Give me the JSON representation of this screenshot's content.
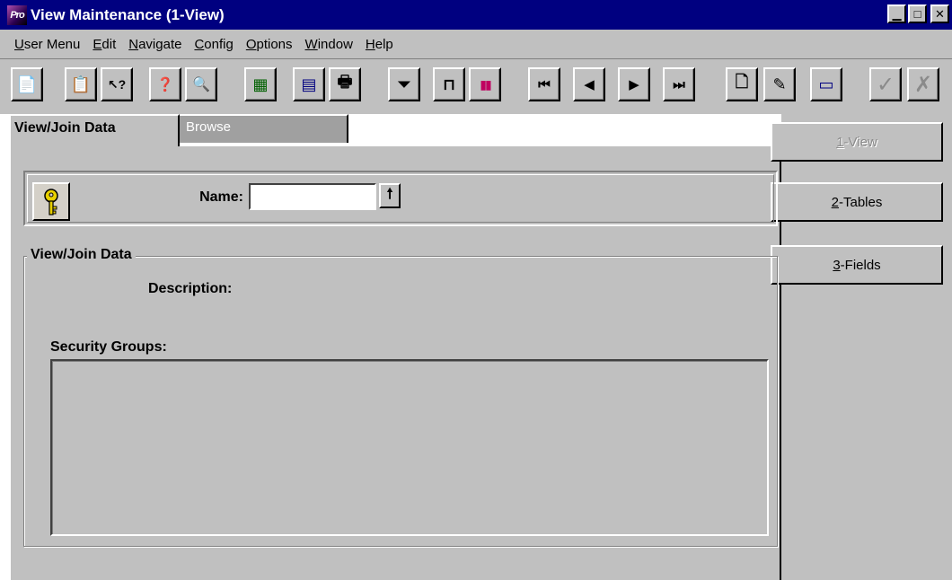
{
  "window": {
    "app_icon_text": "Pro",
    "title": "View Maintenance (1-View)",
    "controls": {
      "minimize": "▁",
      "maximize": "□",
      "close": "✕"
    }
  },
  "menubar": {
    "items": [
      "User Menu",
      "Edit",
      "Navigate",
      "Config",
      "Options",
      "Window",
      "Help"
    ]
  },
  "toolbar": {
    "buttons": [
      {
        "icon": "copy-icon",
        "glyph": "📄",
        "enabled": true
      },
      {
        "icon": "paste-icon",
        "glyph": "📋",
        "enabled": true
      },
      {
        "icon": "help-pointer-icon",
        "glyph": "↖?",
        "enabled": true
      },
      {
        "icon": "context-help-icon",
        "glyph": "❓",
        "enabled": true
      },
      {
        "icon": "spellcheck-icon",
        "glyph": "🔍",
        "enabled": true
      },
      {
        "icon": "spreadsheet-icon",
        "glyph": "▦",
        "enabled": true
      },
      {
        "icon": "calculator-icon",
        "glyph": "▤",
        "enabled": true
      },
      {
        "icon": "print-icon",
        "glyph": "🖶",
        "enabled": true
      },
      {
        "icon": "filter-icon",
        "glyph": "⏷",
        "enabled": true
      },
      {
        "icon": "report-icon",
        "glyph": "⊓",
        "enabled": true
      },
      {
        "icon": "chart-icon",
        "glyph": "▮▮",
        "enabled": true
      },
      {
        "icon": "first-record-icon",
        "glyph": "⏮",
        "enabled": true
      },
      {
        "icon": "previous-record-icon",
        "glyph": "◀",
        "enabled": true
      },
      {
        "icon": "next-record-icon",
        "glyph": "▶",
        "enabled": true
      },
      {
        "icon": "last-record-icon",
        "glyph": "⏭",
        "enabled": true
      },
      {
        "icon": "new-record-icon",
        "glyph": "🗋",
        "enabled": true
      },
      {
        "icon": "edit-record-icon",
        "glyph": "✎",
        "enabled": true
      },
      {
        "icon": "delete-record-icon",
        "glyph": "▭",
        "enabled": true
      },
      {
        "icon": "save-check-icon",
        "glyph": "✓",
        "enabled": false
      },
      {
        "icon": "cancel-icon",
        "glyph": "✗",
        "enabled": false
      }
    ]
  },
  "tabs": [
    {
      "label": "View/Join Data",
      "active": true
    },
    {
      "label": "Browse",
      "active": false
    }
  ],
  "key_section": {
    "icon": "key-icon",
    "name_label": "Name:",
    "name_value": "",
    "lookup_glyph": "🠕"
  },
  "group": {
    "legend": "View/Join Data",
    "description_label": "Description:",
    "security_groups_label": "Security Groups:"
  },
  "side_buttons": [
    {
      "label": "1-View",
      "enabled": false
    },
    {
      "label": "2-Tables",
      "enabled": true
    },
    {
      "label": "3-Fields",
      "enabled": true
    }
  ],
  "colors": {
    "title_bar": "#000080",
    "face": "#c0c0c0",
    "inactive_tab": "#a0a0a0"
  }
}
